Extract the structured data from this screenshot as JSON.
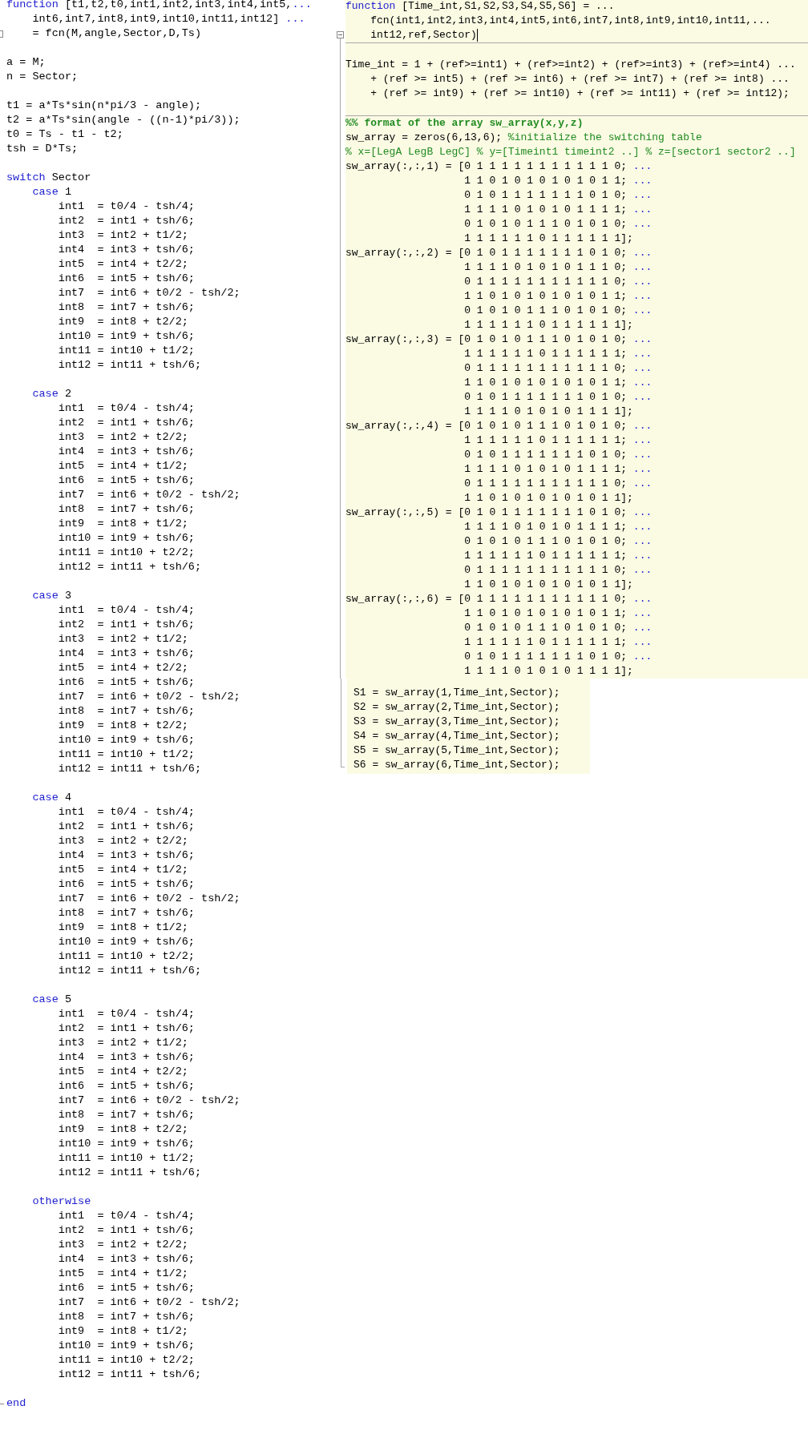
{
  "left_editor": {
    "lines": [
      {
        "kind": "code",
        "parts": [
          {
            "kind": "keyword",
            "text": "function"
          },
          {
            "kind": "plain",
            "text": " [t1,t2,t0,int1,int2,int3,int4,int5,"
          },
          {
            "kind": "continuation",
            "text": "..."
          }
        ]
      },
      {
        "kind": "code",
        "parts": [
          {
            "kind": "plain",
            "text": "    int6,int7,int8,int9,int10,int11,int12] "
          },
          {
            "kind": "continuation",
            "text": "..."
          }
        ]
      },
      {
        "kind": "code",
        "text": "    = fcn(M,angle,Sector,D,Ts)",
        "fold": true
      },
      {
        "kind": "blank"
      },
      {
        "kind": "code",
        "text": "a = M;"
      },
      {
        "kind": "code",
        "text": "n = Sector;"
      },
      {
        "kind": "blank"
      },
      {
        "kind": "code",
        "text": "t1 = a*Ts*sin(n*pi/3 - angle);"
      },
      {
        "kind": "code",
        "text": "t2 = a*Ts*sin(angle - ((n-1)*pi/3));"
      },
      {
        "kind": "code",
        "text": "t0 = Ts - t1 - t2;"
      },
      {
        "kind": "code",
        "text": "tsh = D*Ts;"
      },
      {
        "kind": "blank"
      },
      {
        "kind": "code",
        "parts": [
          {
            "kind": "keyword",
            "text": "switch"
          },
          {
            "kind": "plain",
            "text": " Sector"
          }
        ]
      },
      {
        "kind": "code",
        "parts": [
          {
            "kind": "keyword",
            "text": "    case"
          },
          {
            "kind": "plain",
            "text": " 1"
          }
        ]
      },
      {
        "kind": "code",
        "text": "        int1  = t0/4 - tsh/4;"
      },
      {
        "kind": "code",
        "text": "        int2  = int1 + tsh/6;"
      },
      {
        "kind": "code",
        "text": "        int3  = int2 + t1/2;"
      },
      {
        "kind": "code",
        "text": "        int4  = int3 + tsh/6;"
      },
      {
        "kind": "code",
        "text": "        int5  = int4 + t2/2;"
      },
      {
        "kind": "code",
        "text": "        int6  = int5 + tsh/6;"
      },
      {
        "kind": "code",
        "text": "        int7  = int6 + t0/2 - tsh/2;"
      },
      {
        "kind": "code",
        "text": "        int8  = int7 + tsh/6;"
      },
      {
        "kind": "code",
        "text": "        int9  = int8 + t2/2;"
      },
      {
        "kind": "code",
        "text": "        int10 = int9 + tsh/6;"
      },
      {
        "kind": "code",
        "text": "        int11 = int10 + t1/2;"
      },
      {
        "kind": "code",
        "text": "        int12 = int11 + tsh/6;"
      },
      {
        "kind": "blank"
      },
      {
        "kind": "code",
        "parts": [
          {
            "kind": "keyword",
            "text": "    case"
          },
          {
            "kind": "plain",
            "text": " 2"
          }
        ]
      },
      {
        "kind": "code",
        "text": "        int1  = t0/4 - tsh/4;"
      },
      {
        "kind": "code",
        "text": "        int2  = int1 + tsh/6;"
      },
      {
        "kind": "code",
        "text": "        int3  = int2 + t2/2;"
      },
      {
        "kind": "code",
        "text": "        int4  = int3 + tsh/6;"
      },
      {
        "kind": "code",
        "text": "        int5  = int4 + t1/2;"
      },
      {
        "kind": "code",
        "text": "        int6  = int5 + tsh/6;"
      },
      {
        "kind": "code",
        "text": "        int7  = int6 + t0/2 - tsh/2;"
      },
      {
        "kind": "code",
        "text": "        int8  = int7 + tsh/6;"
      },
      {
        "kind": "code",
        "text": "        int9  = int8 + t1/2;"
      },
      {
        "kind": "code",
        "text": "        int10 = int9 + tsh/6;"
      },
      {
        "kind": "code",
        "text": "        int11 = int10 + t2/2;"
      },
      {
        "kind": "code",
        "text": "        int12 = int11 + tsh/6;"
      },
      {
        "kind": "blank"
      },
      {
        "kind": "code",
        "parts": [
          {
            "kind": "keyword",
            "text": "    case"
          },
          {
            "kind": "plain",
            "text": " 3"
          }
        ]
      },
      {
        "kind": "code",
        "text": "        int1  = t0/4 - tsh/4;"
      },
      {
        "kind": "code",
        "text": "        int2  = int1 + tsh/6;"
      },
      {
        "kind": "code",
        "text": "        int3  = int2 + t1/2;"
      },
      {
        "kind": "code",
        "text": "        int4  = int3 + tsh/6;"
      },
      {
        "kind": "code",
        "text": "        int5  = int4 + t2/2;"
      },
      {
        "kind": "code",
        "text": "        int6  = int5 + tsh/6;"
      },
      {
        "kind": "code",
        "text": "        int7  = int6 + t0/2 - tsh/2;"
      },
      {
        "kind": "code",
        "text": "        int8  = int7 + tsh/6;"
      },
      {
        "kind": "code",
        "text": "        int9  = int8 + t2/2;"
      },
      {
        "kind": "code",
        "text": "        int10 = int9 + tsh/6;"
      },
      {
        "kind": "code",
        "text": "        int11 = int10 + t1/2;"
      },
      {
        "kind": "code",
        "text": "        int12 = int11 + tsh/6;"
      },
      {
        "kind": "blank"
      },
      {
        "kind": "code",
        "parts": [
          {
            "kind": "keyword",
            "text": "    case"
          },
          {
            "kind": "plain",
            "text": " 4"
          }
        ]
      },
      {
        "kind": "code",
        "text": "        int1  = t0/4 - tsh/4;"
      },
      {
        "kind": "code",
        "text": "        int2  = int1 + tsh/6;"
      },
      {
        "kind": "code",
        "text": "        int3  = int2 + t2/2;"
      },
      {
        "kind": "code",
        "text": "        int4  = int3 + tsh/6;"
      },
      {
        "kind": "code",
        "text": "        int5  = int4 + t1/2;"
      },
      {
        "kind": "code",
        "text": "        int6  = int5 + tsh/6;"
      },
      {
        "kind": "code",
        "text": "        int7  = int6 + t0/2 - tsh/2;"
      },
      {
        "kind": "code",
        "text": "        int8  = int7 + tsh/6;"
      },
      {
        "kind": "code",
        "text": "        int9  = int8 + t1/2;"
      },
      {
        "kind": "code",
        "text": "        int10 = int9 + tsh/6;"
      },
      {
        "kind": "code",
        "text": "        int11 = int10 + t2/2;"
      },
      {
        "kind": "code",
        "text": "        int12 = int11 + tsh/6;"
      },
      {
        "kind": "blank"
      },
      {
        "kind": "code",
        "parts": [
          {
            "kind": "keyword",
            "text": "    case"
          },
          {
            "kind": "plain",
            "text": " 5"
          }
        ]
      },
      {
        "kind": "code",
        "text": "        int1  = t0/4 - tsh/4;"
      },
      {
        "kind": "code",
        "text": "        int2  = int1 + tsh/6;"
      },
      {
        "kind": "code",
        "text": "        int3  = int2 + t1/2;"
      },
      {
        "kind": "code",
        "text": "        int4  = int3 + tsh/6;"
      },
      {
        "kind": "code",
        "text": "        int5  = int4 + t2/2;"
      },
      {
        "kind": "code",
        "text": "        int6  = int5 + tsh/6;"
      },
      {
        "kind": "code",
        "text": "        int7  = int6 + t0/2 - tsh/2;"
      },
      {
        "kind": "code",
        "text": "        int8  = int7 + tsh/6;"
      },
      {
        "kind": "code",
        "text": "        int9  = int8 + t2/2;"
      },
      {
        "kind": "code",
        "text": "        int10 = int9 + tsh/6;"
      },
      {
        "kind": "code",
        "text": "        int11 = int10 + t1/2;"
      },
      {
        "kind": "code",
        "text": "        int12 = int11 + tsh/6;"
      },
      {
        "kind": "blank"
      },
      {
        "kind": "code",
        "parts": [
          {
            "kind": "keyword",
            "text": "    otherwise"
          }
        ]
      },
      {
        "kind": "code",
        "text": "        int1  = t0/4 - tsh/4;"
      },
      {
        "kind": "code",
        "text": "        int2  = int1 + tsh/6;"
      },
      {
        "kind": "code",
        "text": "        int3  = int2 + t2/2;"
      },
      {
        "kind": "code",
        "text": "        int4  = int3 + tsh/6;"
      },
      {
        "kind": "code",
        "text": "        int5  = int4 + t1/2;"
      },
      {
        "kind": "code",
        "text": "        int6  = int5 + tsh/6;"
      },
      {
        "kind": "code",
        "text": "        int7  = int6 + t0/2 - tsh/2;"
      },
      {
        "kind": "code",
        "text": "        int8  = int7 + tsh/6;"
      },
      {
        "kind": "code",
        "text": "        int9  = int8 + t1/2;"
      },
      {
        "kind": "code",
        "text": "        int10 = int9 + tsh/6;"
      },
      {
        "kind": "code",
        "text": "        int11 = int10 + t2/2;"
      },
      {
        "kind": "code",
        "text": "        int12 = int11 + tsh/6;"
      },
      {
        "kind": "blank"
      },
      {
        "kind": "code",
        "parts": [
          {
            "kind": "keyword",
            "text": "end"
          }
        ],
        "fold_end": true
      }
    ]
  },
  "right_editor": {
    "cells": [
      {
        "lines": [
          {
            "kind": "code",
            "parts": [
              {
                "kind": "keyword",
                "text": "function"
              },
              {
                "kind": "plain",
                "text": " [Time_int,S1,S2,S3,S4,S5,S6] = ..."
              }
            ]
          },
          {
            "kind": "code",
            "text": "    fcn(int1,int2,int3,int4,int5,int6,int7,int8,int9,int10,int11,..."
          },
          {
            "kind": "code",
            "text": "    int12,ref,Sector)",
            "fold": true,
            "cursor": true
          }
        ]
      },
      {
        "lines": [
          {
            "kind": "blank"
          },
          {
            "kind": "code",
            "text": "Time_int = 1 + (ref>=int1) + (ref>=int2) + (ref>=int3) + (ref>=int4) ..."
          },
          {
            "kind": "code",
            "text": "    + (ref >= int5) + (ref >= int6) + (ref >= int7) + (ref >= int8) ..."
          },
          {
            "kind": "code",
            "text": "    + (ref >= int9) + (ref >= int10) + (ref >= int11) + (ref >= int12);"
          },
          {
            "kind": "blank"
          }
        ]
      },
      {
        "lines": [
          {
            "kind": "code",
            "parts": [
              {
                "kind": "cell_title",
                "text": "%% format of the array sw_array(x,y,z)"
              }
            ]
          },
          {
            "kind": "code",
            "parts": [
              {
                "kind": "plain",
                "text": "sw_array = zeros(6,13,6); "
              },
              {
                "kind": "comment",
                "text": "%initialize the switching table"
              }
            ]
          },
          {
            "kind": "code",
            "parts": [
              {
                "kind": "comment",
                "text": "% x=[LegA LegB LegC] % y=[Timeint1 timeint2 ..] % z=[sector1 sector2 ..]"
              }
            ]
          },
          {
            "kind": "code",
            "parts": [
              {
                "kind": "plain",
                "text": "sw_array(:,:,1) = [0 1 1 1 1 1 1 1 1 1 1 1 0; "
              },
              {
                "kind": "continuation",
                "text": "..."
              }
            ]
          },
          {
            "kind": "code",
            "parts": [
              {
                "kind": "plain",
                "text": "                   1 1 0 1 0 1 0 1 0 1 0 1 1; "
              },
              {
                "kind": "continuation",
                "text": "..."
              }
            ]
          },
          {
            "kind": "code",
            "parts": [
              {
                "kind": "plain",
                "text": "                   0 1 0 1 1 1 1 1 1 1 0 1 0; "
              },
              {
                "kind": "continuation",
                "text": "..."
              }
            ]
          },
          {
            "kind": "code",
            "parts": [
              {
                "kind": "plain",
                "text": "                   1 1 1 1 0 1 0 1 0 1 1 1 1; "
              },
              {
                "kind": "continuation",
                "text": "..."
              }
            ]
          },
          {
            "kind": "code",
            "parts": [
              {
                "kind": "plain",
                "text": "                   0 1 0 1 0 1 1 1 0 1 0 1 0; "
              },
              {
                "kind": "continuation",
                "text": "..."
              }
            ]
          },
          {
            "kind": "code",
            "text": "                   1 1 1 1 1 1 0 1 1 1 1 1 1];"
          },
          {
            "kind": "code",
            "parts": [
              {
                "kind": "plain",
                "text": "sw_array(:,:,2) = [0 1 0 1 1 1 1 1 1 1 0 1 0; "
              },
              {
                "kind": "continuation",
                "text": "..."
              }
            ]
          },
          {
            "kind": "code",
            "parts": [
              {
                "kind": "plain",
                "text": "                   1 1 1 1 0 1 0 1 0 1 1 1 0; "
              },
              {
                "kind": "continuation",
                "text": "..."
              }
            ]
          },
          {
            "kind": "code",
            "parts": [
              {
                "kind": "plain",
                "text": "                   0 1 1 1 1 1 1 1 1 1 1 1 0; "
              },
              {
                "kind": "continuation",
                "text": "..."
              }
            ]
          },
          {
            "kind": "code",
            "parts": [
              {
                "kind": "plain",
                "text": "                   1 1 0 1 0 1 0 1 0 1 0 1 1; "
              },
              {
                "kind": "continuation",
                "text": "..."
              }
            ]
          },
          {
            "kind": "code",
            "parts": [
              {
                "kind": "plain",
                "text": "                   0 1 0 1 0 1 1 1 0 1 0 1 0; "
              },
              {
                "kind": "continuation",
                "text": "..."
              }
            ]
          },
          {
            "kind": "code",
            "text": "                   1 1 1 1 1 1 0 1 1 1 1 1 1];"
          },
          {
            "kind": "code",
            "parts": [
              {
                "kind": "plain",
                "text": "sw_array(:,:,3) = [0 1 0 1 0 1 1 1 0 1 0 1 0; "
              },
              {
                "kind": "continuation",
                "text": "..."
              }
            ]
          },
          {
            "kind": "code",
            "parts": [
              {
                "kind": "plain",
                "text": "                   1 1 1 1 1 1 0 1 1 1 1 1 1; "
              },
              {
                "kind": "continuation",
                "text": "..."
              }
            ]
          },
          {
            "kind": "code",
            "parts": [
              {
                "kind": "plain",
                "text": "                   0 1 1 1 1 1 1 1 1 1 1 1 0; "
              },
              {
                "kind": "continuation",
                "text": "..."
              }
            ]
          },
          {
            "kind": "code",
            "parts": [
              {
                "kind": "plain",
                "text": "                   1 1 0 1 0 1 0 1 0 1 0 1 1; "
              },
              {
                "kind": "continuation",
                "text": "..."
              }
            ]
          },
          {
            "kind": "code",
            "parts": [
              {
                "kind": "plain",
                "text": "                   0 1 0 1 1 1 1 1 1 1 0 1 0; "
              },
              {
                "kind": "continuation",
                "text": "..."
              }
            ]
          },
          {
            "kind": "code",
            "text": "                   1 1 1 1 0 1 0 1 0 1 1 1 1];"
          },
          {
            "kind": "code",
            "parts": [
              {
                "kind": "plain",
                "text": "sw_array(:,:,4) = [0 1 0 1 0 1 1 1 0 1 0 1 0; "
              },
              {
                "kind": "continuation",
                "text": "..."
              }
            ]
          },
          {
            "kind": "code",
            "parts": [
              {
                "kind": "plain",
                "text": "                   1 1 1 1 1 1 0 1 1 1 1 1 1; "
              },
              {
                "kind": "continuation",
                "text": "..."
              }
            ]
          },
          {
            "kind": "code",
            "parts": [
              {
                "kind": "plain",
                "text": "                   0 1 0 1 1 1 1 1 1 1 0 1 0; "
              },
              {
                "kind": "continuation",
                "text": "..."
              }
            ]
          },
          {
            "kind": "code",
            "parts": [
              {
                "kind": "plain",
                "text": "                   1 1 1 1 0 1 0 1 0 1 1 1 1; "
              },
              {
                "kind": "continuation",
                "text": "..."
              }
            ]
          },
          {
            "kind": "code",
            "parts": [
              {
                "kind": "plain",
                "text": "                   0 1 1 1 1 1 1 1 1 1 1 1 0; "
              },
              {
                "kind": "continuation",
                "text": "..."
              }
            ]
          },
          {
            "kind": "code",
            "text": "                   1 1 0 1 0 1 0 1 0 1 0 1 1];"
          },
          {
            "kind": "code",
            "parts": [
              {
                "kind": "plain",
                "text": "sw_array(:,:,5) = [0 1 0 1 1 1 1 1 1 1 0 1 0; "
              },
              {
                "kind": "continuation",
                "text": "..."
              }
            ]
          },
          {
            "kind": "code",
            "parts": [
              {
                "kind": "plain",
                "text": "                   1 1 1 1 0 1 0 1 0 1 1 1 1; "
              },
              {
                "kind": "continuation",
                "text": "..."
              }
            ]
          },
          {
            "kind": "code",
            "parts": [
              {
                "kind": "plain",
                "text": "                   0 1 0 1 0 1 1 1 0 1 0 1 0; "
              },
              {
                "kind": "continuation",
                "text": "..."
              }
            ]
          },
          {
            "kind": "code",
            "parts": [
              {
                "kind": "plain",
                "text": "                   1 1 1 1 1 1 0 1 1 1 1 1 1; "
              },
              {
                "kind": "continuation",
                "text": "..."
              }
            ]
          },
          {
            "kind": "code",
            "parts": [
              {
                "kind": "plain",
                "text": "                   0 1 1 1 1 1 1 1 1 1 1 1 0; "
              },
              {
                "kind": "continuation",
                "text": "..."
              }
            ]
          },
          {
            "kind": "code",
            "text": "                   1 1 0 1 0 1 0 1 0 1 0 1 1];"
          },
          {
            "kind": "code",
            "parts": [
              {
                "kind": "plain",
                "text": "sw_array(:,:,6) = [0 1 1 1 1 1 1 1 1 1 1 1 0; "
              },
              {
                "kind": "continuation",
                "text": "..."
              }
            ]
          },
          {
            "kind": "code",
            "parts": [
              {
                "kind": "plain",
                "text": "                   1 1 0 1 0 1 0 1 0 1 0 1 1; "
              },
              {
                "kind": "continuation",
                "text": "..."
              }
            ]
          },
          {
            "kind": "code",
            "parts": [
              {
                "kind": "plain",
                "text": "                   0 1 0 1 0 1 1 1 0 1 0 1 0; "
              },
              {
                "kind": "continuation",
                "text": "..."
              }
            ]
          },
          {
            "kind": "code",
            "parts": [
              {
                "kind": "plain",
                "text": "                   1 1 1 1 1 1 0 1 1 1 1 1 1; "
              },
              {
                "kind": "continuation",
                "text": "..."
              }
            ]
          },
          {
            "kind": "code",
            "parts": [
              {
                "kind": "plain",
                "text": "                   0 1 0 1 1 1 1 1 1 1 0 1 0; "
              },
              {
                "kind": "continuation",
                "text": "..."
              }
            ]
          },
          {
            "kind": "code",
            "text": "                   1 1 1 1 0 1 0 1 0 1 1 1 1];"
          }
        ]
      }
    ]
  },
  "output_block": {
    "lines": [
      {
        "kind": "code",
        "text": "S1 = sw_array(1,Time_int,Sector);"
      },
      {
        "kind": "code",
        "text": "S2 = sw_array(2,Time_int,Sector);"
      },
      {
        "kind": "code",
        "text": "S3 = sw_array(3,Time_int,Sector);"
      },
      {
        "kind": "code",
        "text": "S4 = sw_array(4,Time_int,Sector);"
      },
      {
        "kind": "code",
        "text": "S5 = sw_array(5,Time_int,Sector);"
      },
      {
        "kind": "code",
        "text": "S6 = sw_array(6,Time_int,Sector);"
      }
    ]
  }
}
